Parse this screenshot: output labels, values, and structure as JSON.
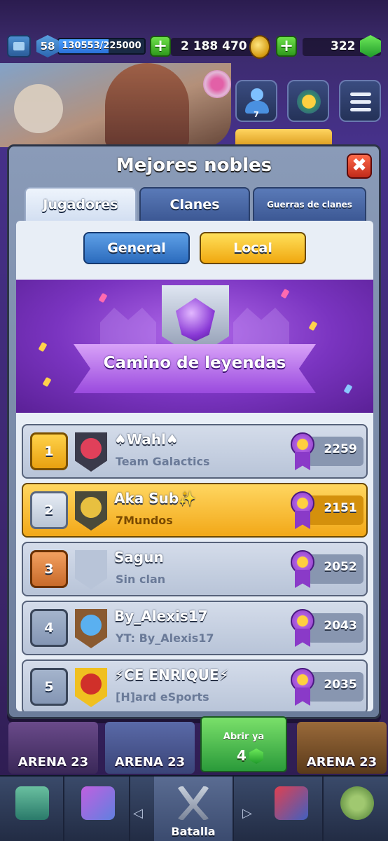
{
  "hud": {
    "level": "58",
    "xp_text": "130553/225000",
    "xp_progress": 0.58,
    "plus": "+",
    "gold": "2 188 470",
    "gems": "322",
    "friends_count": "7"
  },
  "modal": {
    "title": "Mejores nobles",
    "close": "✖",
    "tabs": [
      {
        "label": "Jugadores"
      },
      {
        "label": "Clanes"
      },
      {
        "label": "Guerras de clanes"
      }
    ],
    "filters": {
      "general": "General",
      "local": "Local"
    },
    "banner_title": "Camino de leyendas"
  },
  "leaderboard": [
    {
      "rank": "1",
      "name": "♠Wahl♠",
      "clan": "Team Galactics",
      "score": "2259",
      "badge_color": "#3a3a4a",
      "badge_inner": "#e0405a"
    },
    {
      "rank": "2",
      "name": "Aka Sub✨",
      "clan": "7Mundos",
      "score": "2151",
      "badge_color": "#4a4a3a",
      "badge_inner": "#e8c040"
    },
    {
      "rank": "3",
      "name": "Sagun",
      "clan": "Sin clan",
      "score": "2052",
      "badge_color": "#b8c4d8",
      "badge_inner": "#b8c4d8"
    },
    {
      "rank": "4",
      "name": "By_Alexis17",
      "clan": "YT: By_Alexis17",
      "score": "2043",
      "badge_color": "#8a5a30",
      "badge_inner": "#5ab0f0"
    },
    {
      "rank": "5",
      "name": "⚡CE ENRIQUE⚡",
      "clan": "[H]ard eSports",
      "score": "2035",
      "badge_color": "#f0c020",
      "badge_inner": "#d0302a"
    }
  ],
  "chests": [
    {
      "label": "ARENA 23"
    },
    {
      "label": "ARENA 23"
    },
    {
      "label": "ARENA 23"
    }
  ],
  "open_chest": {
    "label": "Abrir ya",
    "cost": "4"
  },
  "nav": {
    "battle_label": "Batalla",
    "left_arrow": "◁",
    "right_arrow": "▷"
  },
  "colors": {
    "accent_gold": "#f0a810",
    "accent_blue": "#2b6bbd",
    "banner_purple": "#7a34c0"
  }
}
